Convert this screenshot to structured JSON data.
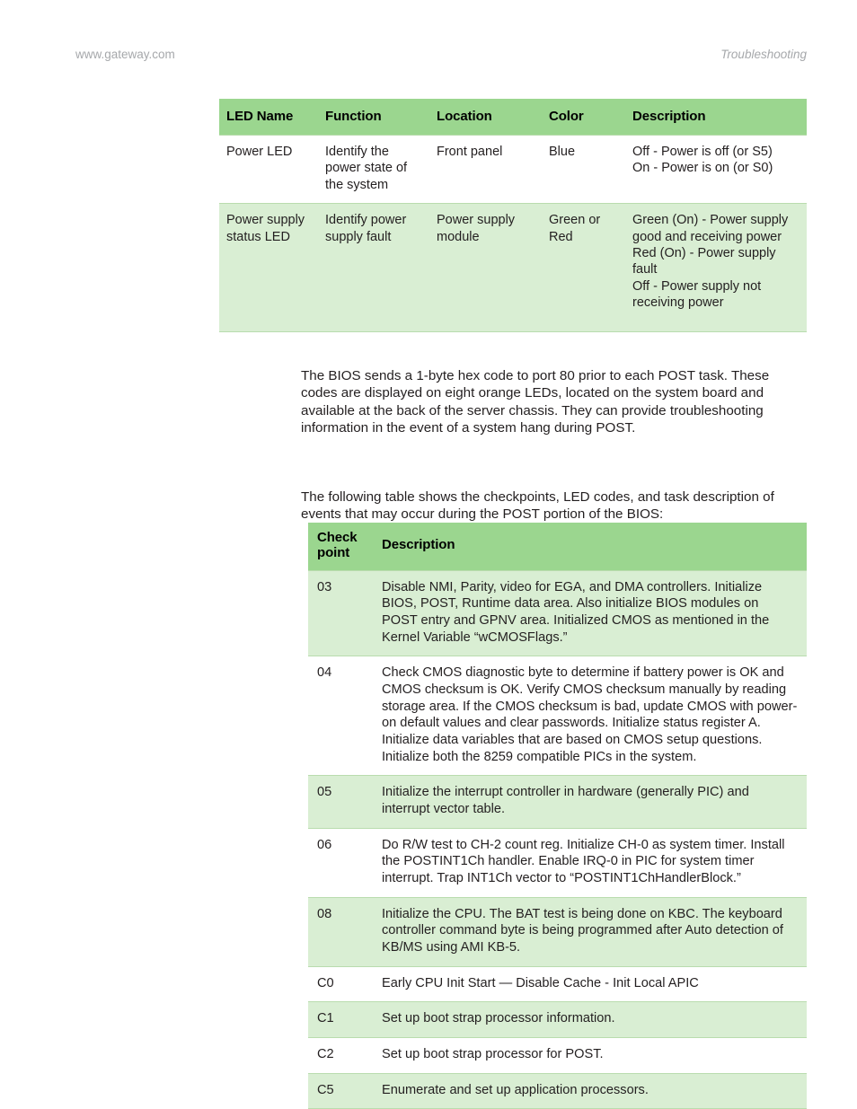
{
  "header": {
    "left": "www.gateway.com",
    "right": "Troubleshooting"
  },
  "colors": {
    "header_green": "#9bd68f",
    "row_green": "#d9eed3",
    "rule": "#b9dcae",
    "header_text": "#a6a8ab",
    "body_text": "#231f20"
  },
  "led_table": {
    "columns": [
      "LED Name",
      "Function",
      "Location",
      "Color",
      "Description"
    ],
    "rows": [
      {
        "name": "Power LED",
        "function": "Identify the power state of the system",
        "location": "Front panel",
        "color": "Blue",
        "description_lines": [
          "Off - Power is off (or S5)",
          "On - Power is on (or S0)"
        ]
      },
      {
        "name": "Power supply status LED",
        "function": "Identify power supply fault",
        "location": "Power supply module",
        "color": "Green or Red",
        "description_lines": [
          "Green (On) - Power supply good and receiving power",
          "Red (On) - Power supply fault",
          "Off - Power supply not receiving power"
        ]
      }
    ]
  },
  "paragraphs": {
    "para_1": "The BIOS sends a 1-byte hex code to port 80 prior to each POST task. These codes are displayed on eight orange LEDs, located on the system board and available at the back of the server chassis. They can provide troubleshooting information in the event of a system hang during POST.",
    "para_2": "The following table shows the checkpoints, LED codes, and task description of events that may occur during the POST portion of the BIOS:"
  },
  "checkpoint_table": {
    "columns": [
      "Check point",
      "Description"
    ],
    "column_header_line_1": "Check",
    "column_header_line_2": "point",
    "rows": [
      {
        "code": "03",
        "description": "Disable NMI, Parity, video for EGA, and DMA controllers. Initialize BIOS, POST, Runtime data area. Also initialize BIOS modules on POST entry and GPNV area. Initialized CMOS as mentioned in the Kernel Variable “wCMOSFlags.”"
      },
      {
        "code": "04",
        "description": "Check CMOS diagnostic byte to determine if battery power is OK and CMOS checksum is OK. Verify CMOS checksum manually by reading storage area. If the CMOS checksum is bad, update CMOS with power-on default values and clear passwords. Initialize status register A. Initialize data variables that are based on CMOS setup questions. Initialize both the 8259 compatible PICs in the system."
      },
      {
        "code": "05",
        "description": "Initialize the interrupt controller in hardware (generally PIC) and interrupt vector table."
      },
      {
        "code": "06",
        "description": "Do R/W test to CH-2 count reg. Initialize CH-0 as system timer. Install the POSTINT1Ch handler. Enable IRQ-0 in PIC for system timer interrupt. Trap INT1Ch vector to “POSTINT1ChHandlerBlock.”"
      },
      {
        "code": "08",
        "description": "Initialize the CPU. The BAT test is being done on KBC. The keyboard controller command byte is being programmed after Auto detection of KB/MS using AMI KB-5."
      },
      {
        "code": "C0",
        "description": "Early CPU Init Start — Disable Cache - Init Local APIC"
      },
      {
        "code": "C1",
        "description": "Set up boot strap processor information."
      },
      {
        "code": "C2",
        "description": "Set up boot strap processor for POST."
      },
      {
        "code": "C5",
        "description": "Enumerate and set up application processors."
      }
    ]
  }
}
